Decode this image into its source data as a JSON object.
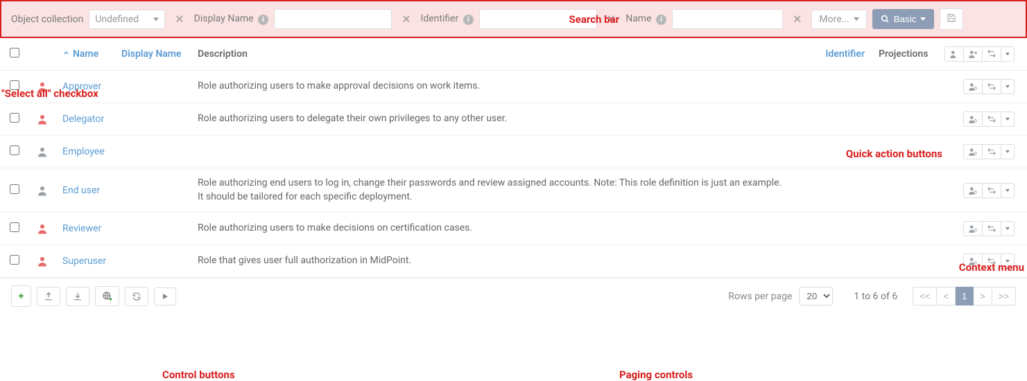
{
  "search": {
    "obj_collection_label": "Object collection",
    "obj_collection_value": "Undefined",
    "display_name_label": "Display Name",
    "display_name_value": "",
    "identifier_label": "Identifier",
    "identifier_value": "",
    "name_label": "Name",
    "name_value": "",
    "more_label": "More...",
    "basic_label": "Basic"
  },
  "annotations": {
    "search_bar": "Search bar",
    "select_all": "\"Select all\" checkbox",
    "quick_actions": "Quick action buttons",
    "context_menu": "Context menu",
    "control_buttons": "Control buttons",
    "paging_controls": "Paging controls"
  },
  "columns": {
    "name": "Name",
    "display_name": "Display Name",
    "description": "Description",
    "identifier": "Identifier",
    "projections": "Projections"
  },
  "rows": [
    {
      "name": "Approver",
      "icon_color": "#e86a6a",
      "description": "Role authorizing users to make approval decisions on work items."
    },
    {
      "name": "Delegator",
      "icon_color": "#e86a6a",
      "description": "Role authorizing users to delegate their own privileges to any other user."
    },
    {
      "name": "Employee",
      "icon_color": "#9aa0a6",
      "description": ""
    },
    {
      "name": "End user",
      "icon_color": "#9aa0a6",
      "description": "Role authorizing end users to log in, change their passwords and review assigned accounts. Note: This role definition is just an example. It should be tailored for each specific deployment."
    },
    {
      "name": "Reviewer",
      "icon_color": "#e86a6a",
      "description": "Role authorizing users to make decisions on certification cases."
    },
    {
      "name": "Superuser",
      "icon_color": "#e86a6a",
      "description": "Role that gives user full authorization in MidPoint."
    }
  ],
  "footer": {
    "rows_per_page_label": "Rows per page",
    "rows_per_page_value": "20",
    "range_text": "1 to 6 of 6",
    "current_page": "1"
  }
}
